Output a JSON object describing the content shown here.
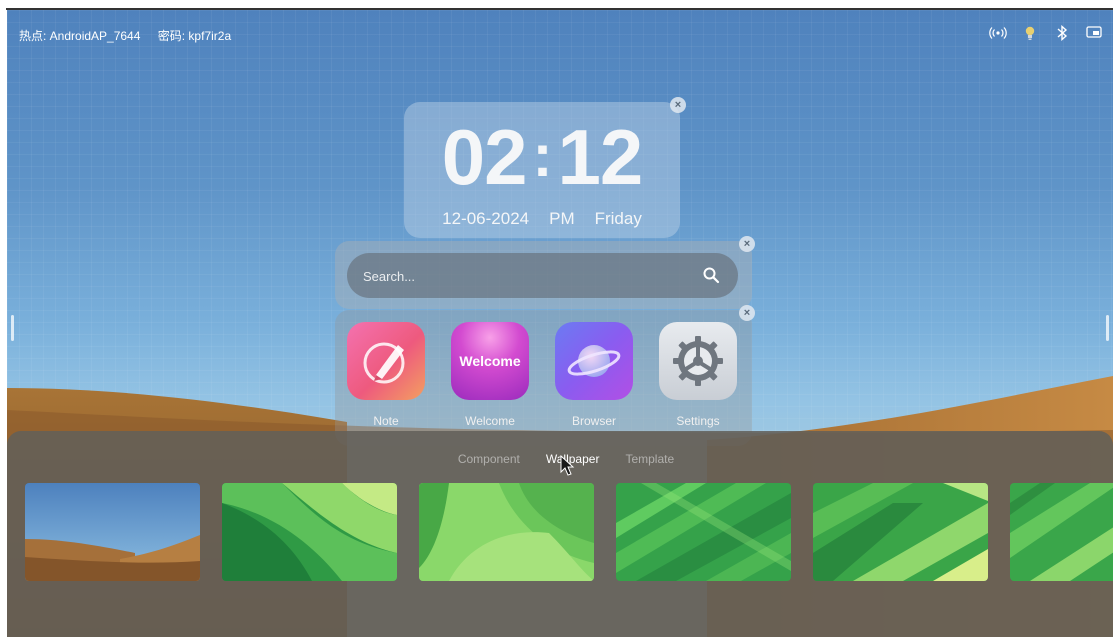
{
  "status_bar": {
    "hotspot": "热点: AndroidAP_7644",
    "password": "密码: kpf7ir2a",
    "icons": [
      "hotspot-icon",
      "bulb-icon",
      "bluetooth-icon",
      "screen-cast-icon"
    ]
  },
  "clock": {
    "hours": "02",
    "minutes": "12",
    "date": "12-06-2024",
    "ampm": "PM",
    "weekday": "Friday"
  },
  "search": {
    "placeholder": "Search..."
  },
  "apps": [
    {
      "label": "Note",
      "icon": "note-icon"
    },
    {
      "label": "Welcome",
      "icon": "welcome-icon",
      "icon_text": "Welcome"
    },
    {
      "label": "Browser",
      "icon": "browser-icon"
    },
    {
      "label": "Settings",
      "icon": "settings-icon"
    }
  ],
  "panel": {
    "tabs": [
      {
        "label": "Component",
        "active": false
      },
      {
        "label": "Wallpaper",
        "active": true
      },
      {
        "label": "Template",
        "active": false
      }
    ],
    "wallpapers": [
      "desert-dunes",
      "green-waves-1",
      "green-waves-2",
      "green-stripes-1",
      "green-stripes-2",
      "green-stripes-3"
    ]
  },
  "colors": {
    "sky": "#5f94c8",
    "sand": "#b07a3e",
    "panel": "#62605a",
    "accent_green": "#3fb24f"
  }
}
